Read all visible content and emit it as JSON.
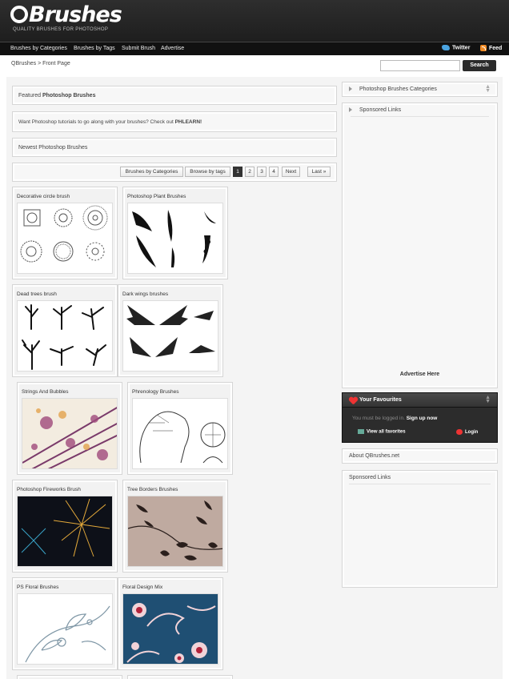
{
  "header": {
    "logo_text": "Brushes",
    "tagline": "QUALITY BRUSHES FOR PHOTOSHOP"
  },
  "nav": {
    "items": [
      "Brushes by Categories",
      "Brushes by Tags",
      "Submit Brush",
      "Advertise"
    ],
    "twitter": "Twitter",
    "feed": "Feed"
  },
  "breadcrumb": "QBrushes > Front Page",
  "search": {
    "placeholder": "",
    "button": "Search"
  },
  "main": {
    "featured_prefix": "Featured ",
    "featured_bold": "Photoshop Brushes",
    "promo_text": "Want Photoshop tutorials to go along with your brushes? Check out ",
    "promo_link": "PHLEARN!",
    "newest_title": "Newest Photoshop Brushes",
    "pager": {
      "by_categories": "Brushes by Categories",
      "by_tags": "Browse by tags",
      "pages": [
        "1",
        "2",
        "3",
        "4"
      ],
      "next": "Next",
      "last": "Last »"
    }
  },
  "cards": [
    {
      "title": "Decorative circle brush"
    },
    {
      "title": "Photoshop Plant Brushes"
    },
    {
      "title": "Dead trees brush"
    },
    {
      "title": "Dark wings brushes"
    },
    {
      "title": "Strings And Bubbles"
    },
    {
      "title": "Phrenology Brushes"
    },
    {
      "title": "Photoshop Fireworks Brush"
    },
    {
      "title": "Tree Borders Brushes"
    },
    {
      "title": "PS Floral Brushes"
    },
    {
      "title": "Floral Design Mix"
    }
  ],
  "sidebar": {
    "categories": "Photoshop Brushes Categories",
    "sponsored1": "Sponsored Links",
    "advertise": "Advertise Here",
    "favourites": {
      "title": "Your Favourites",
      "login_text": "You must be logged in.",
      "signup": "Sign up now",
      "view_all": "View all favorites",
      "login": "Login"
    },
    "about": "About QBrushes.net",
    "sponsored2": "Sponsored Links"
  }
}
